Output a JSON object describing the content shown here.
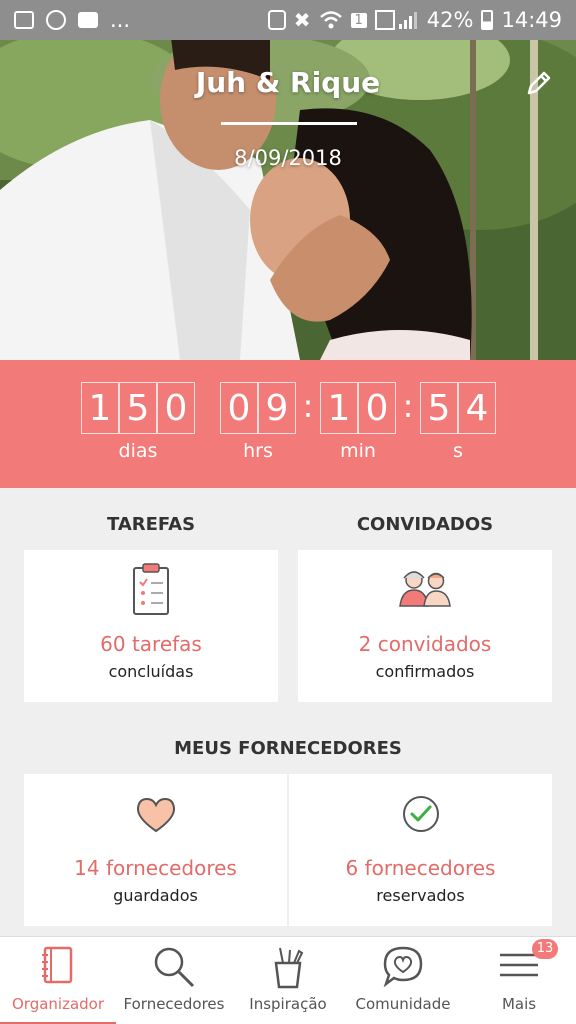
{
  "status_bar": {
    "notifications_more": "...",
    "battery_percent": "42%",
    "time": "14:49",
    "sim_label": "1"
  },
  "hero": {
    "couple_name": "Juh & Rique",
    "wedding_date": "8/09/2018"
  },
  "countdown": {
    "days_digits": [
      "1",
      "5",
      "0"
    ],
    "hours_digits": [
      "0",
      "9"
    ],
    "minutes_digits": [
      "1",
      "0"
    ],
    "seconds_digits": [
      "5",
      "4"
    ],
    "separator": ":",
    "labels": {
      "days": "dias",
      "hours": "hrs",
      "minutes": "min",
      "seconds": "s"
    }
  },
  "tasks": {
    "title": "TAREFAS",
    "count_text": "60 tarefas",
    "sub_text": "concluídas"
  },
  "guests": {
    "title": "CONVIDADOS",
    "count_text": "2 convidados",
    "sub_text": "confirmados"
  },
  "vendors": {
    "title": "MEUS FORNECEDORES",
    "saved": {
      "count_text": "14 fornecedores",
      "sub_text": "guardados"
    },
    "booked": {
      "count_text": "6 fornecedores",
      "sub_text": "reservados"
    }
  },
  "bottom_nav": {
    "items": [
      {
        "label": "Organizador",
        "icon": "notebook-icon",
        "active": true
      },
      {
        "label": "Fornecedores",
        "icon": "search-icon",
        "active": false
      },
      {
        "label": "Inspiração",
        "icon": "inspiration-cup-icon",
        "active": false
      },
      {
        "label": "Comunidade",
        "icon": "chat-heart-icon",
        "active": false
      },
      {
        "label": "Mais",
        "icon": "menu-icon",
        "active": false,
        "badge": "13"
      }
    ]
  },
  "colors": {
    "accent": "#f27a78",
    "accent_text": "#e36b69",
    "background": "#efefef"
  }
}
